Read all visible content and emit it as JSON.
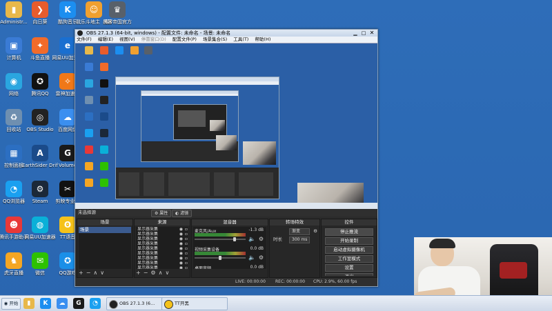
{
  "desktop": {
    "icons": [
      {
        "label": "Administr...",
        "glyph": "▮",
        "color": "#e8b84a",
        "icon": "folder-user-icon"
      },
      {
        "label": "向日葵",
        "glyph": "❯",
        "color": "#e85c2c",
        "icon": "sunflower-icon"
      },
      {
        "label": "酷狗音乐",
        "glyph": "K",
        "color": "#1c8ef0",
        "icon": "kugou-icon"
      },
      {
        "label": "我乐斗地主（最新版本）",
        "glyph": "☺",
        "color": "#f0a030",
        "icon": "game-icon"
      },
      {
        "label": "黑客帝国官方",
        "glyph": "♛",
        "color": "#58606a",
        "icon": "game-icon"
      },
      {
        "label": "计算机",
        "glyph": "▣",
        "color": "#3a7bd5",
        "icon": "computer-icon"
      },
      {
        "label": "斗鱼直播",
        "glyph": "✦",
        "color": "#f26b2a",
        "icon": "douyu-icon"
      },
      {
        "label": "网易UU加速器",
        "glyph": "e",
        "color": "#1a6fd0",
        "icon": "browser-icon"
      },
      {
        "label": "网络",
        "glyph": "◉",
        "color": "#2aa6e0",
        "icon": "network-icon"
      },
      {
        "label": "腾讯QQ",
        "glyph": "✪",
        "color": "#111111",
        "icon": "qq-icon"
      },
      {
        "label": "雷神加速器",
        "glyph": "✧",
        "color": "#f07818",
        "icon": "accelerator-icon"
      },
      {
        "label": "回收站",
        "glyph": "♻",
        "color": "#6f8fb0",
        "icon": "recycle-bin-icon"
      },
      {
        "label": "OBS Studio",
        "glyph": "◎",
        "color": "#222222",
        "icon": "obs-icon"
      },
      {
        "label": "百度网盘",
        "glyph": "☁",
        "color": "#3b8ff0",
        "icon": "cloud-icon"
      },
      {
        "label": "控制面板",
        "glyph": "▦",
        "color": "#2c6fc2",
        "icon": "control-panel-icon"
      },
      {
        "label": "EarthSider Drift Cl...",
        "glyph": "A",
        "color": "#1b4b8a",
        "icon": "app-icon"
      },
      {
        "label": "Volume",
        "glyph": "G",
        "color": "#1a1a1a",
        "icon": "volume-app-icon"
      },
      {
        "label": "QQ浏览器",
        "glyph": "◔",
        "color": "#1aa0f0",
        "icon": "qq-browser-icon"
      },
      {
        "label": "Steam",
        "glyph": "⚙",
        "color": "#1b2838",
        "icon": "steam-icon"
      },
      {
        "label": "剪映专业版",
        "glyph": "✂",
        "color": "#111111",
        "icon": "capcut-icon"
      },
      {
        "label": "腾讯手游助手",
        "glyph": "☻",
        "color": "#e83838",
        "icon": "game-assistant-icon"
      },
      {
        "label": "网易UU加速器",
        "glyph": "◍",
        "color": "#0ab0d8",
        "icon": "uu-icon"
      },
      {
        "label": "TT语音",
        "glyph": "ʘ",
        "color": "#f5c21a",
        "icon": "tt-voice-icon"
      },
      {
        "label": "虎牙直播",
        "glyph": "♞",
        "color": "#f5a623",
        "icon": "huya-icon"
      },
      {
        "label": "微信",
        "glyph": "✉",
        "color": "#2dc100",
        "icon": "wechat-icon"
      },
      {
        "label": "QQ游戏",
        "glyph": "✪",
        "color": "#1a8fe8",
        "icon": "qq-game-icon"
      }
    ]
  },
  "obs": {
    "title": "OBS 27.1.3 (64-bit, windows) - 配置文件: 未命名 - 场景: 未命名",
    "menu": [
      "文件(F)",
      "编辑(E)",
      "视图(V)",
      "停靠窗口(D)",
      "配置文件(P)",
      "场景集合(S)",
      "工具(T)",
      "帮助(H)"
    ],
    "scene_label": "未选择源",
    "toolbar_buttons": [
      "属性",
      "滤镜"
    ],
    "docks": {
      "scenes": {
        "title": "场景",
        "items": [
          "场景"
        ]
      },
      "sources": {
        "title": "来源",
        "items": [
          "显示器采集",
          "显示器采集",
          "显示器采集",
          "显示器采集",
          "显示器采集",
          "显示器采集",
          "显示器采集",
          "显示器采集",
          "显示器采集",
          "显示器采集",
          "显示器采集",
          "显示器采集",
          "显示器采集",
          "显示器采集",
          "显示器采集",
          "显示器采集"
        ]
      },
      "mixer": {
        "title": "混音器",
        "channels": [
          {
            "name": "麦克风/Aux",
            "db": "-1.3 dB",
            "level": 0.78
          },
          {
            "name": "视频采集设备",
            "db": "0.0 dB",
            "level": 0.5
          },
          {
            "name": "桌面音频",
            "db": "0.0 dB",
            "level": 0.88
          }
        ]
      },
      "transitions": {
        "title": "转场特效",
        "type_value": "渐变",
        "duration_label": "时长",
        "duration_value": "300 ms"
      },
      "controls": {
        "title": "控件",
        "buttons": [
          "停止推流",
          "开始录制",
          "启动虚拟摄像机",
          "工作室模式",
          "设置",
          "退出"
        ]
      }
    },
    "status": {
      "live": "LIVE: 00:00:00",
      "rec": "REC: 00:00:00",
      "cpu": "CPU: 2.9%, 60.00 fps"
    }
  },
  "taskbar": {
    "start": "开始",
    "tasks": [
      {
        "label": "OBS 27.1.3 (6...",
        "icon": "obs-icon"
      },
      {
        "label": "TT开黑",
        "icon": "tt-icon"
      }
    ]
  }
}
